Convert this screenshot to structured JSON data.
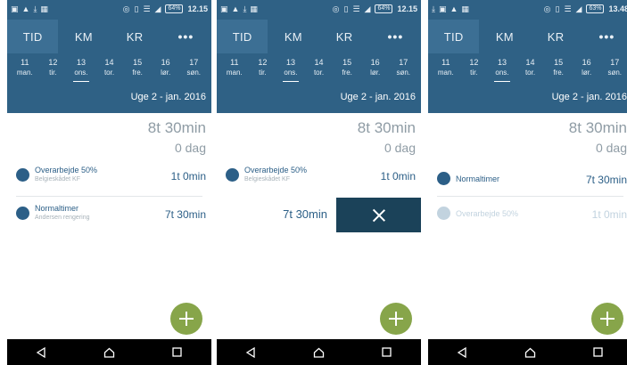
{
  "colors": {
    "header": "#2f6185",
    "active_tab": "#3c6f94",
    "accent_text": "#2c5f87",
    "muted_text": "#8f9ca5",
    "fab": "#87a54a",
    "delete_bg": "#1b4259",
    "faded": "#c2d3df"
  },
  "tabs": [
    "TID",
    "KM",
    "KR",
    "•••"
  ],
  "days": [
    {
      "num": "11",
      "wd": "man."
    },
    {
      "num": "12",
      "wd": "tir."
    },
    {
      "num": "13",
      "wd": "ons."
    },
    {
      "num": "14",
      "wd": "tor."
    },
    {
      "num": "15",
      "wd": "fre."
    },
    {
      "num": "16",
      "wd": "lør."
    },
    {
      "num": "17",
      "wd": "søn."
    }
  ],
  "week_label": "Uge 2 - jan. 2016",
  "screens": [
    {
      "time": "12.15",
      "battery": "64%",
      "total_hours": "8t 30min",
      "total_days": "0 dag",
      "entries": [
        {
          "title": "Overarbejde 50%",
          "sub": "Belgieskådet KF",
          "duration": "1t 0min"
        },
        {
          "title": "Normaltimer",
          "sub": "Andersen rengering",
          "duration": "7t 30min"
        }
      ]
    },
    {
      "time": "12.15",
      "battery": "64%",
      "total_hours": "8t 30min",
      "total_days": "0 dag",
      "entries": [
        {
          "title": "Overarbejde 50%",
          "sub": "Belgieskådet KF",
          "duration": "1t 0min"
        }
      ],
      "swipe_value": "7t 30min"
    },
    {
      "time": "13.48",
      "battery": "63%",
      "total_hours": "8t 30min",
      "total_days": "0 dag",
      "entries": [
        {
          "title": "Normaltimer",
          "duration": "7t 30min"
        },
        {
          "title": "Overarbejde 50%",
          "duration": "1t 0min"
        }
      ]
    }
  ],
  "icons": {
    "status_left_0": [
      "sim-icon",
      "warning-icon",
      "download-icon",
      "clipboard-icon"
    ],
    "status_left_2": [
      "download-icon",
      "sim-icon",
      "warning-icon",
      "clipboard-icon"
    ],
    "status_right": [
      "vibrate-icon",
      "phone-icon",
      "wifi-icon",
      "signal-icon",
      "battery-icon"
    ],
    "nav": [
      "back-icon",
      "home-icon",
      "recents-icon"
    ],
    "fab": "plus-icon",
    "delete": "close-icon"
  }
}
